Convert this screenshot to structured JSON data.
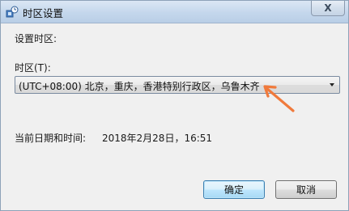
{
  "window": {
    "title": "时区设置",
    "close_glyph": "X"
  },
  "form": {
    "section_label": "设置时区:",
    "timezone_label": "时区(T):",
    "timezone_value": "(UTC+08:00) 北京，重庆，香港特别行政区，乌鲁木齐",
    "datetime_label": "当前日期和时间:",
    "datetime_value": "2018年2月28日，16:51"
  },
  "buttons": {
    "ok_label": "确定",
    "cancel_label": "取消"
  },
  "colors": {
    "annotation_arrow": "#f07a3c",
    "default_button_border": "#3c7fb1"
  },
  "icons": {
    "title": "clock-settings-icon",
    "combo": "chevron-down-icon",
    "annotation": "arrow-annotation"
  }
}
